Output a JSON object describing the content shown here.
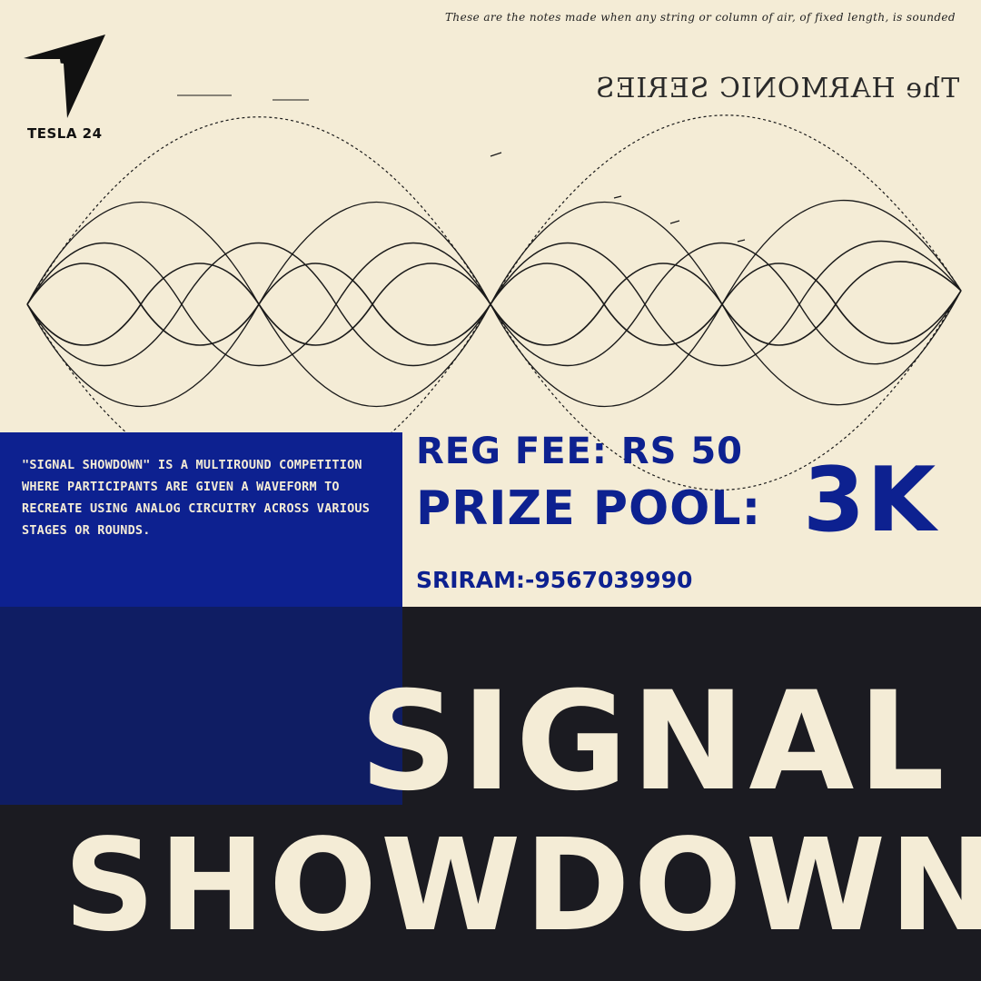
{
  "brand": {
    "name": "TESLA 24",
    "icon": "tesla-arrow-icon"
  },
  "sketch": {
    "note_top": "These are the notes made when any string or column of air, of fixed length, is sounded",
    "title": "The HARMONIC SERIES"
  },
  "event": {
    "description": "\"SIGNAL SHOWDOWN\" IS A MULTIROUND COMPETITION WHERE PARTICIPANTS ARE GIVEN A WAVEFORM TO RECREATE USING ANALOG CIRCUITRY ACROSS VARIOUS STAGES OR ROUNDS.",
    "reg_fee": "REG FEE: RS 50",
    "prize_label": "PRIZE POOL:",
    "prize_value": "3K",
    "contact": "SRIRAM:-9567039990",
    "title_line1": "SIGNAL",
    "title_line2": "SHOWDOWN"
  },
  "colors": {
    "background": "#f4ecd6",
    "accent_blue": "#0d2190",
    "dark": "#1b1b21",
    "ink": "#111111"
  }
}
